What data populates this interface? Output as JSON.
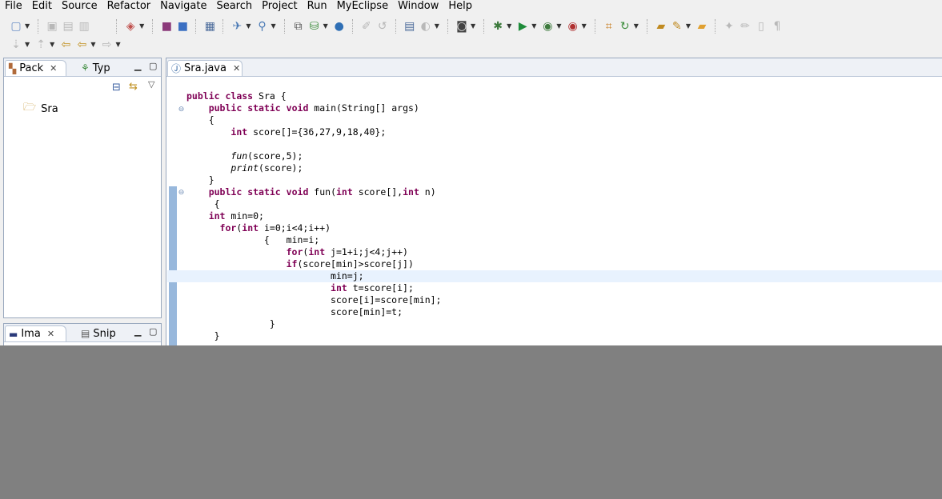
{
  "menubar": {
    "items": [
      "File",
      "Edit",
      "Source",
      "Refactor",
      "Navigate",
      "Search",
      "Project",
      "Run",
      "MyEclipse",
      "Window",
      "Help"
    ]
  },
  "toolbar": {
    "row1_icons": [
      "new-icon",
      "save-icon",
      "save-all-icon",
      "print-icon",
      "new-web-project-icon",
      "package-icon",
      "cube-icon",
      "server-icon",
      "web-icon",
      "search-icon",
      "deploy-icon",
      "db-icon",
      "globe-icon",
      "open-perspective-icon",
      "sync-icon",
      "config-icon",
      "camera-icon",
      "debug-icon",
      "run-icon",
      "run-coverage-icon",
      "external-tools-icon",
      "open-type-icon",
      "refresh-icon",
      "open-folder-icon",
      "wand-icon",
      "folder-icon",
      "tools-icon",
      "pen-icon",
      "page-icon",
      "pilcrow-icon"
    ],
    "row2_icons": [
      "next-annotation-icon",
      "prev-annotation-icon",
      "last-edit-icon",
      "back-icon",
      "forward-icon"
    ]
  },
  "package_explorer": {
    "tabs": [
      {
        "label": "Pack",
        "icon": "package-explorer-icon",
        "active": true
      },
      {
        "label": "Typ",
        "icon": "type-hierarchy-icon",
        "active": false
      }
    ],
    "tree": [
      {
        "label": "Sra",
        "icon": "project-folder-icon"
      }
    ]
  },
  "bottom_view": {
    "tabs": [
      {
        "label": "Ima",
        "icon": "image-view-icon",
        "active": true
      },
      {
        "label": "Snip",
        "icon": "snippets-icon",
        "active": false
      }
    ]
  },
  "editor": {
    "tab_label": "Sra.java",
    "tab_icon": "java-file-icon",
    "code_lines": [
      "public class Sra {",
      "    public static void main(String[] args)",
      "    {",
      "        int score[]={36,27,9,18,40};",
      "",
      "        fun(score,5);",
      "        print(score);",
      "    }",
      "    public static void fun(int score[],int n)",
      "     {",
      "    int min=0;",
      "      for(int i=0;i<4;i++)",
      "              {   min=i;",
      "                  for(int j=1+i;j<4;j++)",
      "                  if(score[min]>score[j])",
      "                          min=j;",
      "                          int t=score[i];",
      "                          score[i]=score[min];",
      "                          score[min]=t;",
      "               }",
      "     }"
    ],
    "current_line_index": 15
  }
}
